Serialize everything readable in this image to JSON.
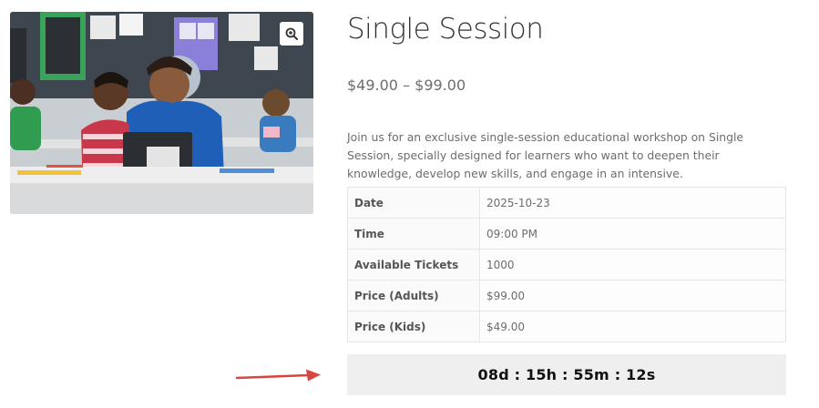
{
  "product": {
    "title": "Single Session",
    "price_range": "$49.00 – $99.00",
    "description": "Join us for an exclusive single-session educational workshop on Single Session, specially designed for learners who want to deepen their knowledge, develop new skills, and engage in an intensive."
  },
  "details": [
    {
      "label": "Date",
      "value": "2025-10-23"
    },
    {
      "label": "Time",
      "value": "09:00 PM"
    },
    {
      "label": "Available Tickets",
      "value": "1000"
    },
    {
      "label": "Price (Adults)",
      "value": "$99.00"
    },
    {
      "label": "Price (Kids)",
      "value": "$49.00"
    }
  ],
  "countdown": {
    "text": "08d : 15h : 55m : 12s"
  },
  "icons": {
    "zoom": "magnifier-plus-icon",
    "annotation": "red-arrow-icon"
  },
  "colors": {
    "arrow": "#d9453f",
    "countdown_bg": "#efefef",
    "title": "#333333"
  }
}
